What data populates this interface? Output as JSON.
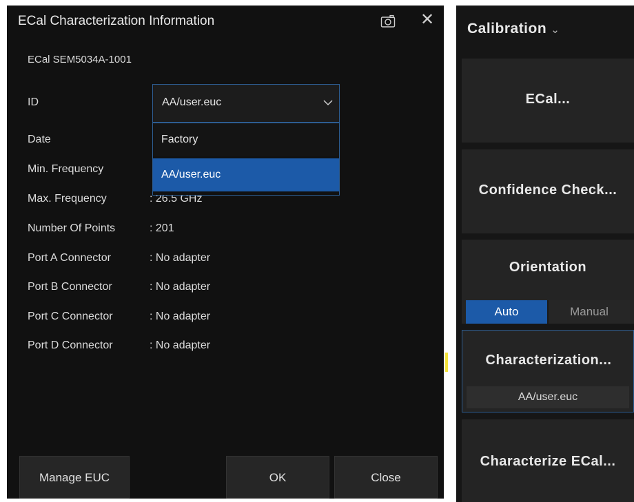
{
  "dialog": {
    "title": "ECal Characterization Information",
    "subtitle": "ECal SEM5034A-1001",
    "camera_icon": "camera-icon",
    "close_icon": "close-icon",
    "id_label": "ID",
    "id_select": {
      "value": "AA/user.euc",
      "options": [
        "Factory",
        "AA/user.euc"
      ],
      "selected_index": 1
    },
    "rows": [
      {
        "label": "Date",
        "value": ""
      },
      {
        "label": "Min. Frequency",
        "value": ""
      },
      {
        "label": "Max. Frequency",
        "value": ": 26.5 GHz"
      },
      {
        "label": "Number Of Points",
        "value": ": 201"
      },
      {
        "label": "Port A Connector",
        "value": ": No adapter"
      },
      {
        "label": "Port B Connector",
        "value": ": No adapter"
      },
      {
        "label": "Port C Connector",
        "value": ": No adapter"
      },
      {
        "label": "Port D Connector",
        "value": ": No adapter"
      }
    ],
    "buttons": {
      "manage": "Manage EUC",
      "ok": "OK",
      "close": "Close"
    }
  },
  "panel": {
    "title": "Calibration",
    "title_chevron": "⌄",
    "ecal": "ECal...",
    "confidence": "Confidence Check...",
    "orientation": {
      "label": "Orientation",
      "auto": "Auto",
      "manual": "Manual",
      "selected": "Auto"
    },
    "characterization": {
      "label": "Characterization...",
      "value": "AA/user.euc"
    },
    "characterize": "Characterize ECal..."
  },
  "colors": {
    "accent": "#1c5aa8",
    "border": "#2d5d92",
    "background": "#111111"
  }
}
